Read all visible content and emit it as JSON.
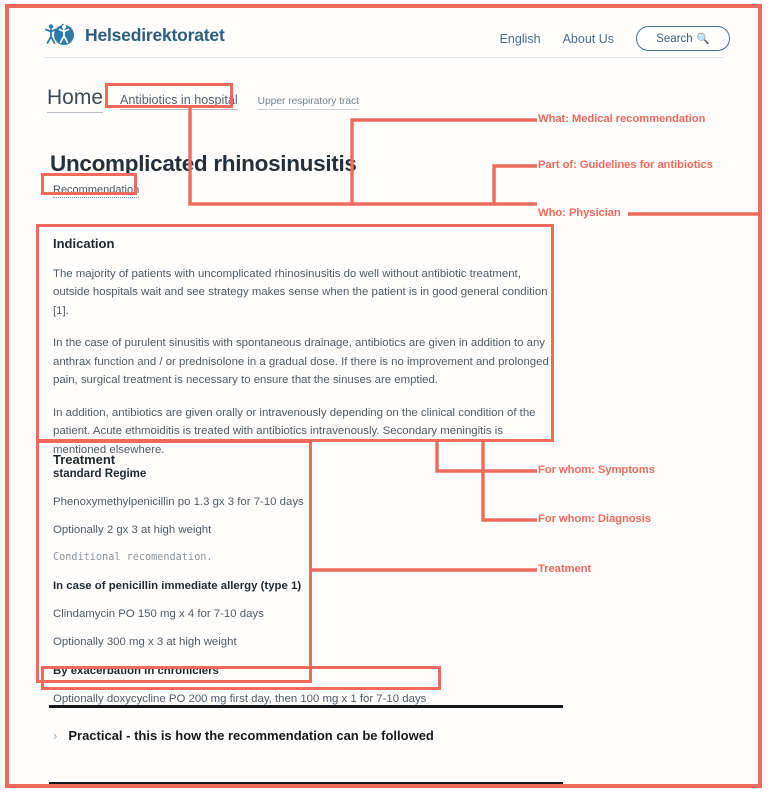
{
  "site": {
    "logo_text": "Helsedirektoratet",
    "logo_icon": "helsedirektoratet-logo-icon",
    "nav": {
      "english": "English",
      "about": "About Us",
      "search_label": "Search",
      "search_icon": "search-icon"
    }
  },
  "breadcrumb": {
    "home": "Home",
    "section": "Antibiotics in hospital",
    "subsection": "Upper respiratory tract"
  },
  "page": {
    "title": "Uncomplicated rhinosinusitis",
    "tag": "Recommendation"
  },
  "indication": {
    "heading": "Indication",
    "paragraphs": [
      "The majority of patients with uncomplicated rhinosinusitis do well without antibiotic treatment, outside hospitals wait and see strategy makes sense when the patient is in good general condition [1].",
      "In the case of purulent sinusitis with spontaneous drainage, antibiotics are given in addition to any anthrax function and / or prednisolone in a gradual dose. If there is no improvement and prolonged pain, surgical treatment is necessary to ensure that the sinuses are emptied.",
      "In addition, antibiotics are given orally or intravenously depending on the clinical condition of the patient. Acute ethmoiditis is treated with antibiotics intravenously. Secondary meningitis is mentioned elsewhere."
    ]
  },
  "treatment": {
    "heading": "Treatment",
    "subheading": "standard Regime",
    "line1": "Phenoxymethylpenicillin po 1.3 gx 3 for 7-10 days",
    "line2": "Optionally 2 gx 3 at high weight",
    "conditional": "Conditional recomendation.",
    "allergy_heading": "In case of penicillin immediate allergy (type 1)",
    "allergy_line1": "Clindamycin PO 150 mg x 4 for 7-10 days",
    "allergy_line2": "Optionally 300 mg x 3 at high weight",
    "chronic_heading": "By exacerbation in chroniclers",
    "chronic_line1": "Optionally doxycycline PO 200 mg first day, then 100 mg x 1 for 7-10 days"
  },
  "accordion": {
    "chevron_icon": "chevron-right-icon",
    "label": "Practical - this is how the recommendation can be followed"
  },
  "annotations": {
    "what": "What: Medical recommendation",
    "part_of": "Part of: Guidelines for antibiotics",
    "who": "Who: Physician",
    "for_whom_symptoms": "For whom: Symptoms",
    "for_whom_diagnosis": "For whom: Diagnosis",
    "treatment": "Treatment",
    "accent_color": "#ef6a5a"
  }
}
